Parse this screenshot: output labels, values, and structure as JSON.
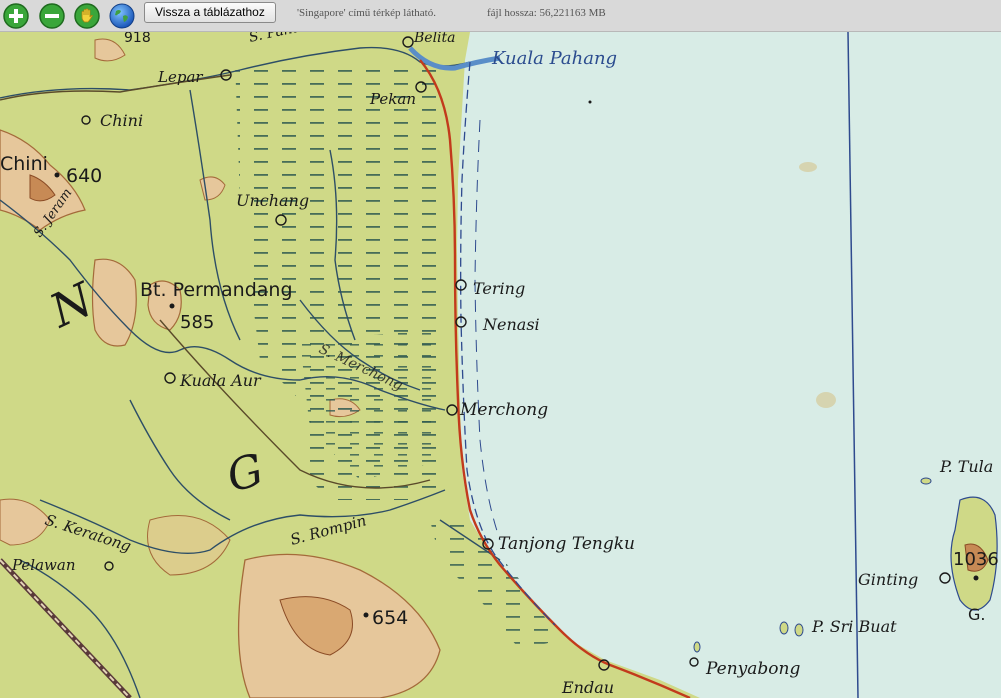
{
  "toolbar": {
    "back_label": "Vissza a táblázathoz",
    "map_info": "'Singapore' című térkép látható.",
    "file_size": "fájl hossza: 56,221163 MB"
  },
  "icons": [
    "zoom-in-icon",
    "zoom-out-icon",
    "pan-hand-icon",
    "globe-icon"
  ],
  "colors": {
    "land": "#cfd987",
    "sea": "#d8ece6",
    "coast": "#c23a1c",
    "river": "#2d4e66",
    "swamp": "#2f5a50"
  },
  "map": {
    "places": {
      "belita": "Belita",
      "kuala_pahang": "Kuala Pahang",
      "lepar": "Lepar",
      "pekan": "Pekan",
      "chini": "Chini",
      "chini_hill": "Chini",
      "elev_640": "640",
      "unchang": "Unchang",
      "permandang": "Bt. Permandang",
      "elev_585": "585",
      "tering": "Tering",
      "nenasi": "Nenasi",
      "merchong_river": "S. Merchong",
      "merchong": "Merchong",
      "kuala_aur": "Kuala Aur",
      "letter_n": "N",
      "letter_g": "G",
      "s_jeram": "S. Jeram",
      "s_pahang": "S. Pahang",
      "s_keratong": "S. Keratong",
      "s_rompin": "S. Rompin",
      "pelawan": "Pelawan",
      "tanjong_tengku": "Tanjong Tengku",
      "elev_654": "654",
      "endau": "Endau",
      "penyabong": "Penyabong",
      "sri_buat": "P. Sri Buat",
      "ginting": "Ginting",
      "p_tula": "P. Tula",
      "elev_1036": "1036",
      "g_island": "G.",
      "elev_918": "918"
    }
  }
}
